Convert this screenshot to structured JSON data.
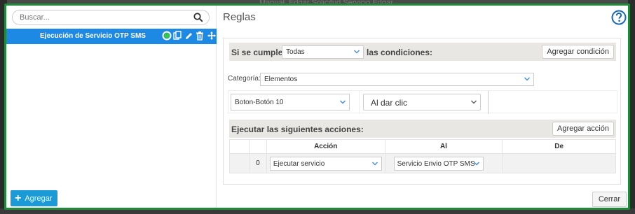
{
  "background": {
    "title": "Manual_Edgar Solicitud Servicio Edgar"
  },
  "left": {
    "search": {
      "placeholder": "Buscar...",
      "value": ""
    },
    "rules": [
      {
        "label": "Ejecución de Servicio OTP SMS",
        "selected": true
      }
    ],
    "add_label": "Agregar"
  },
  "right": {
    "title": "Reglas",
    "conditions": {
      "prefix": "Si se cumplen",
      "match_value": "Todas",
      "suffix": "las condiciones:",
      "add_button": "Agregar condición",
      "category_label": "Categoría:",
      "category_value": "Elementos",
      "element_value": "Boton-Botón 10",
      "event_value": "Al dar clic"
    },
    "actions": {
      "header": "Ejecutar las siguientes acciones:",
      "add_button": "Agregar acción",
      "columns": [
        "Acción",
        "Al",
        "De"
      ],
      "rows": [
        {
          "index": "0",
          "action": "Ejecutar servicio",
          "target": "Servicio Envio OTP SMS",
          "from": ""
        }
      ]
    },
    "close_label": "Cerrar"
  },
  "colors": {
    "accent": "#1e88e5",
    "border": "#1f8a3a",
    "add_button": "#1a9ad6"
  }
}
